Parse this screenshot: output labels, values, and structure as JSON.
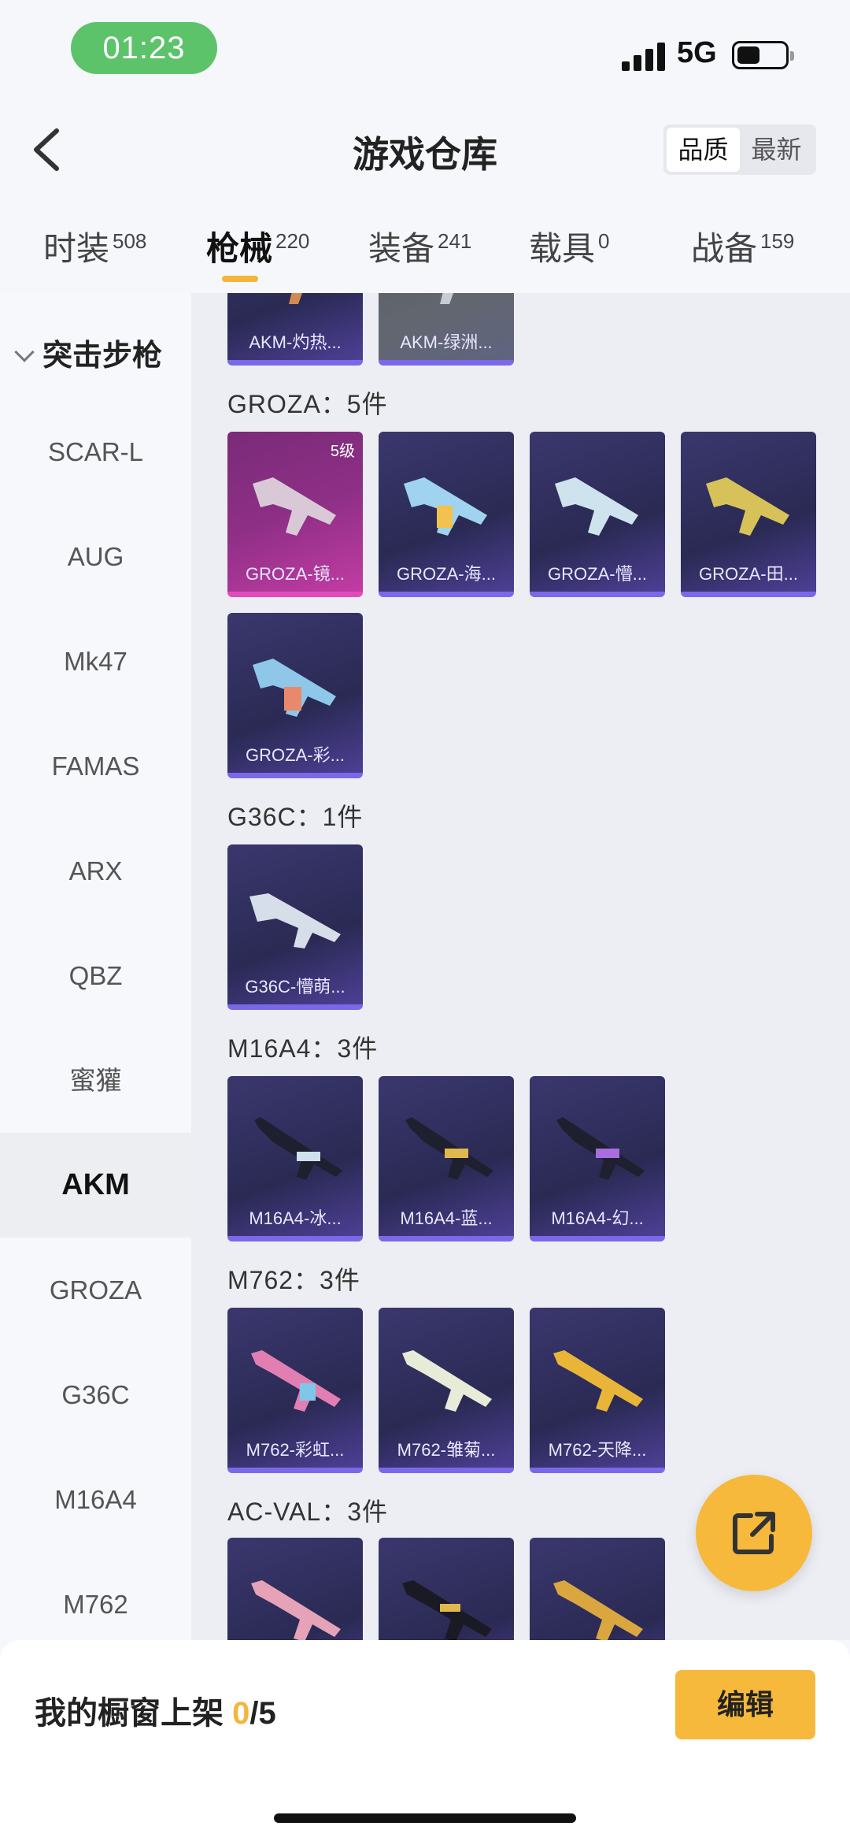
{
  "status": {
    "time": "01:23",
    "network": "5G"
  },
  "header": {
    "title": "游戏仓库",
    "sort_options": [
      "品质",
      "最新"
    ],
    "sort_active": "品质"
  },
  "tabs": [
    {
      "label": "时装",
      "count": "508"
    },
    {
      "label": "枪械",
      "count": "220"
    },
    {
      "label": "装备",
      "count": "241"
    },
    {
      "label": "载具",
      "count": "0"
    },
    {
      "label": "战备",
      "count": "159"
    }
  ],
  "sidebar": {
    "group": "突击步枪",
    "items": [
      "SCAR-L",
      "AUG",
      "Mk47",
      "FAMAS",
      "ARX",
      "QBZ",
      "蜜獾",
      "AKM",
      "GROZA",
      "G36C",
      "M16A4",
      "M762"
    ],
    "active": "AKM"
  },
  "sections": [
    {
      "title": "GROZA：5件"
    },
    {
      "title": "G36C：1件"
    },
    {
      "title": "M16A4：3件"
    },
    {
      "title": "M762：3件"
    },
    {
      "title": "AC-VAL：3件"
    }
  ],
  "cards": {
    "akm_top": [
      "AKM-灼热...",
      "AKM-绿洲..."
    ],
    "groza": [
      "GROZA-镜...",
      "GROZA-海...",
      "GROZA-懵...",
      "GROZA-田...",
      "GROZA-彩..."
    ],
    "groza_level": "5级",
    "g36c": [
      "G36C-懵萌..."
    ],
    "m16a4": [
      "M16A4-冰...",
      "M16A4-蓝...",
      "M16A4-幻..."
    ],
    "m762": [
      "M762-彩虹...",
      "M762-雏菊...",
      "M762-天降..."
    ]
  },
  "bottom": {
    "label": "我的橱窗上架 ",
    "count": "0",
    "total": "/5",
    "edit": "编辑"
  },
  "colors": {
    "accent": "#f6b93b",
    "time_pill": "#5dc36a"
  },
  "icons": {
    "back": "chevron-left-icon",
    "fab": "share-external-icon",
    "group": "chevron-down-icon"
  }
}
